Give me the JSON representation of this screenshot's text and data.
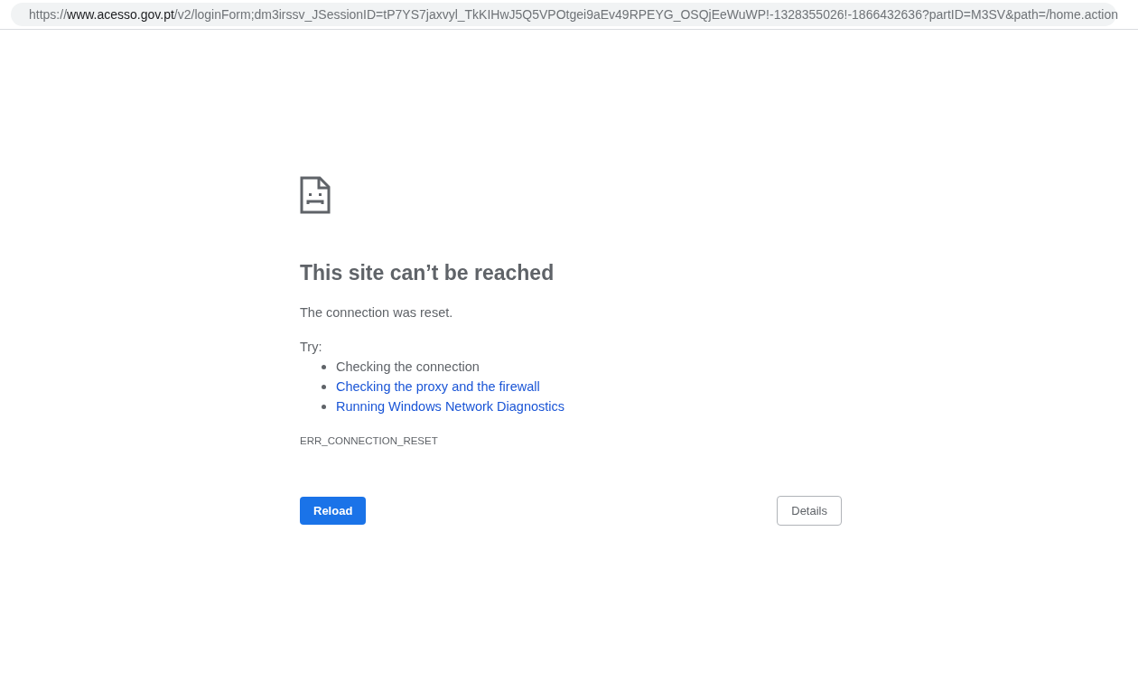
{
  "address_bar": {
    "scheme": "https://",
    "host": "www.acesso.gov.pt",
    "path": "/v2/loginForm;dm3irssv_JSessionID=tP7YS7jaxvyl_TkKIHwJ5Q5VPOtgei9aEv49RPEYG_OSQjEeWuWP!-1328355026!-1866432636?partID=M3SV&path=/home.action"
  },
  "error": {
    "title": "This site can’t be reached",
    "message": "The connection was reset.",
    "try_label": "Try:",
    "suggestions": [
      {
        "kind": "text",
        "text": "Checking the connection"
      },
      {
        "kind": "link",
        "text": "Checking the proxy and the firewall"
      },
      {
        "kind": "link",
        "text": "Running Windows Network Diagnostics"
      }
    ],
    "code": "ERR_CONNECTION_RESET"
  },
  "buttons": {
    "primary": "Reload",
    "secondary": "Details"
  }
}
